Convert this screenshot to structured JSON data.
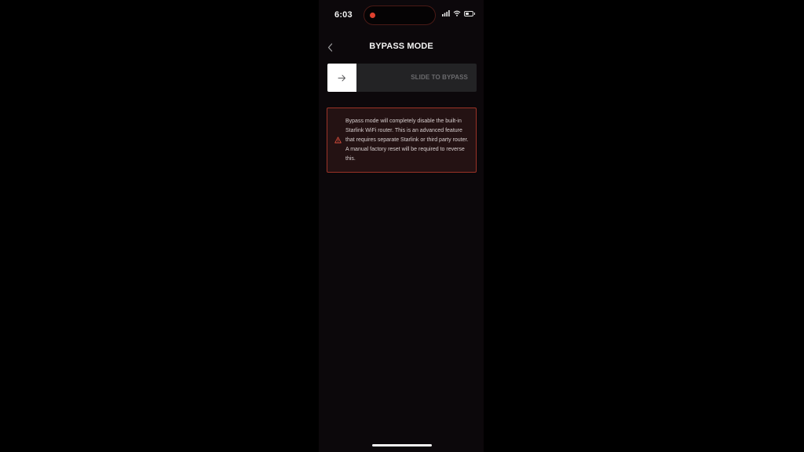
{
  "status_bar": {
    "time": "6:03",
    "icons": [
      "signal-icon",
      "wifi-icon",
      "battery-icon"
    ],
    "recording_color": "#e0412f"
  },
  "header": {
    "title": "BYPASS MODE",
    "back_icon": "chevron-left-icon"
  },
  "slider": {
    "label": "SLIDE TO BYPASS",
    "handle_icon": "arrow-right-icon",
    "progress": 0
  },
  "warning": {
    "icon": "warning-triangle-icon",
    "text": "Bypass mode will completely disable the built-in Starlink WiFi router. This is an advanced feature that requires separate Starlink or third party router. A manual factory reset will be required to reverse this.",
    "border_color": "#9c3328"
  }
}
